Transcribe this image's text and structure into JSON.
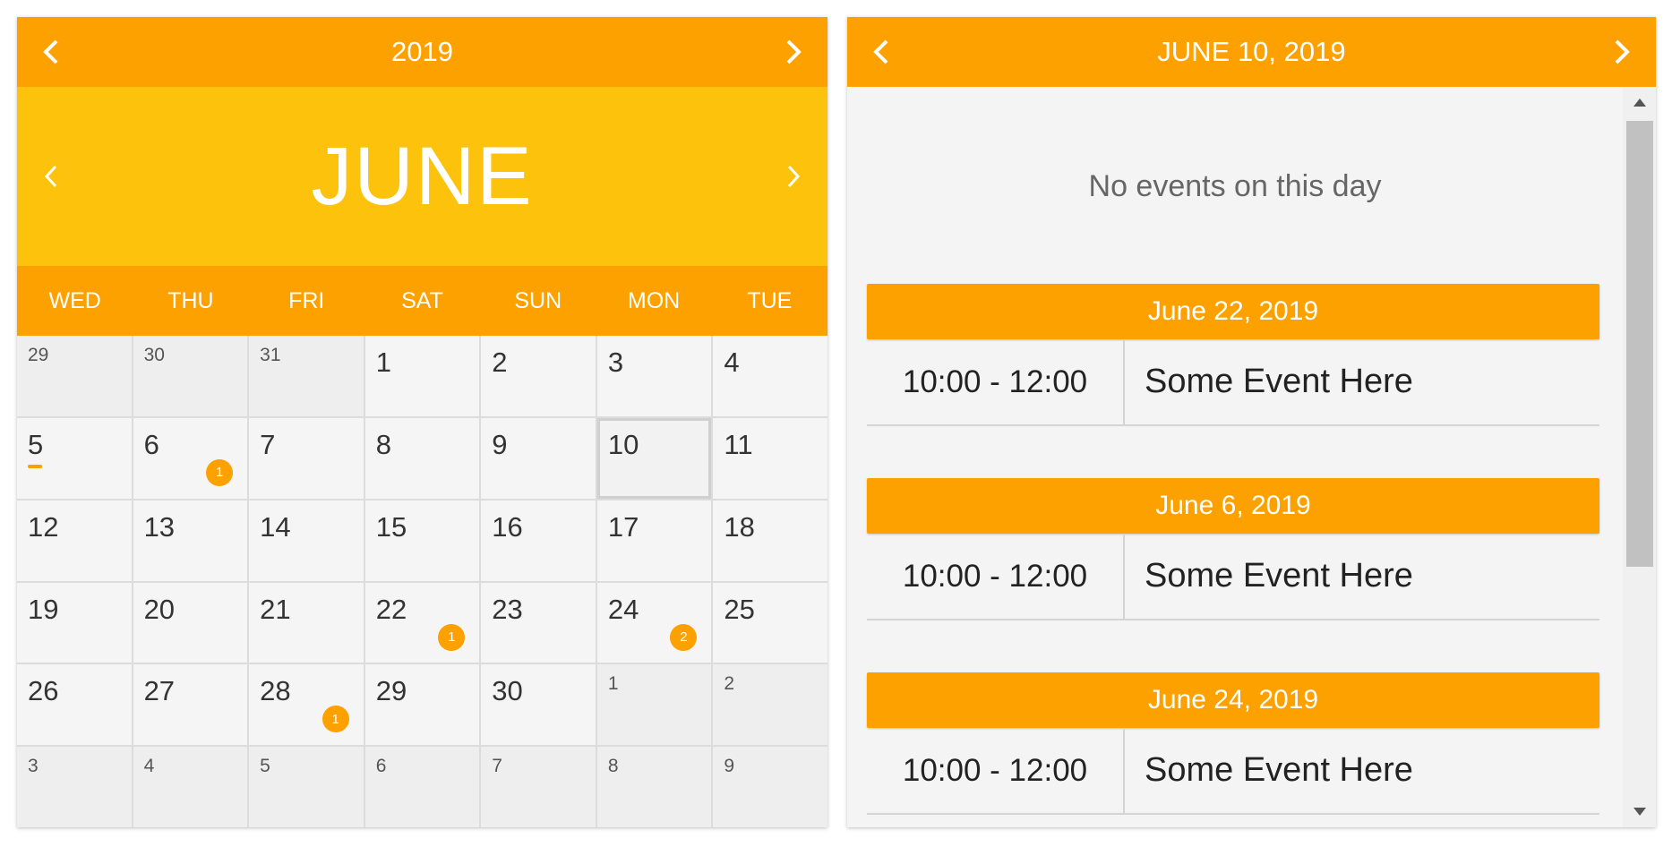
{
  "calendar": {
    "year_label": "2019",
    "month_label": "JUNE",
    "weekdays": [
      "WED",
      "THU",
      "FRI",
      "SAT",
      "SUN",
      "MON",
      "TUE"
    ],
    "weeks": [
      [
        {
          "d": "29",
          "o": true
        },
        {
          "d": "30",
          "o": true
        },
        {
          "d": "31",
          "o": true
        },
        {
          "d": "1"
        },
        {
          "d": "2"
        },
        {
          "d": "3"
        },
        {
          "d": "4"
        }
      ],
      [
        {
          "d": "5",
          "today": true
        },
        {
          "d": "6",
          "badge": "1"
        },
        {
          "d": "7"
        },
        {
          "d": "8"
        },
        {
          "d": "9"
        },
        {
          "d": "10",
          "selected": true
        },
        {
          "d": "11"
        }
      ],
      [
        {
          "d": "12"
        },
        {
          "d": "13"
        },
        {
          "d": "14"
        },
        {
          "d": "15"
        },
        {
          "d": "16"
        },
        {
          "d": "17"
        },
        {
          "d": "18"
        }
      ],
      [
        {
          "d": "19"
        },
        {
          "d": "20"
        },
        {
          "d": "21"
        },
        {
          "d": "22",
          "badge": "1"
        },
        {
          "d": "23"
        },
        {
          "d": "24",
          "badge": "2"
        },
        {
          "d": "25"
        }
      ],
      [
        {
          "d": "26"
        },
        {
          "d": "27"
        },
        {
          "d": "28",
          "badge": "1"
        },
        {
          "d": "29"
        },
        {
          "d": "30"
        },
        {
          "d": "1",
          "o": true
        },
        {
          "d": "2",
          "o": true
        }
      ],
      [
        {
          "d": "3",
          "o": true
        },
        {
          "d": "4",
          "o": true
        },
        {
          "d": "5",
          "o": true
        },
        {
          "d": "6",
          "o": true
        },
        {
          "d": "7",
          "o": true
        },
        {
          "d": "8",
          "o": true
        },
        {
          "d": "9",
          "o": true
        }
      ]
    ]
  },
  "agenda": {
    "date_label": "JUNE 10, 2019",
    "empty_message": "No events on this day",
    "groups": [
      {
        "date": "June 22, 2019",
        "events": [
          {
            "time": "10:00 - 12:00",
            "title": "Some Event Here"
          }
        ]
      },
      {
        "date": "June 6, 2019",
        "events": [
          {
            "time": "10:00 - 12:00",
            "title": "Some Event Here"
          }
        ]
      },
      {
        "date": "June 24, 2019",
        "events": [
          {
            "time": "10:00 - 12:00",
            "title": "Some Event Here"
          }
        ]
      }
    ]
  },
  "colors": {
    "orange": "#fca100",
    "yellow": "#fdc20c"
  },
  "icons": {
    "prev": "chevron-left-icon",
    "next": "chevron-right-icon",
    "up": "triangle-up-icon",
    "down": "triangle-down-icon"
  }
}
